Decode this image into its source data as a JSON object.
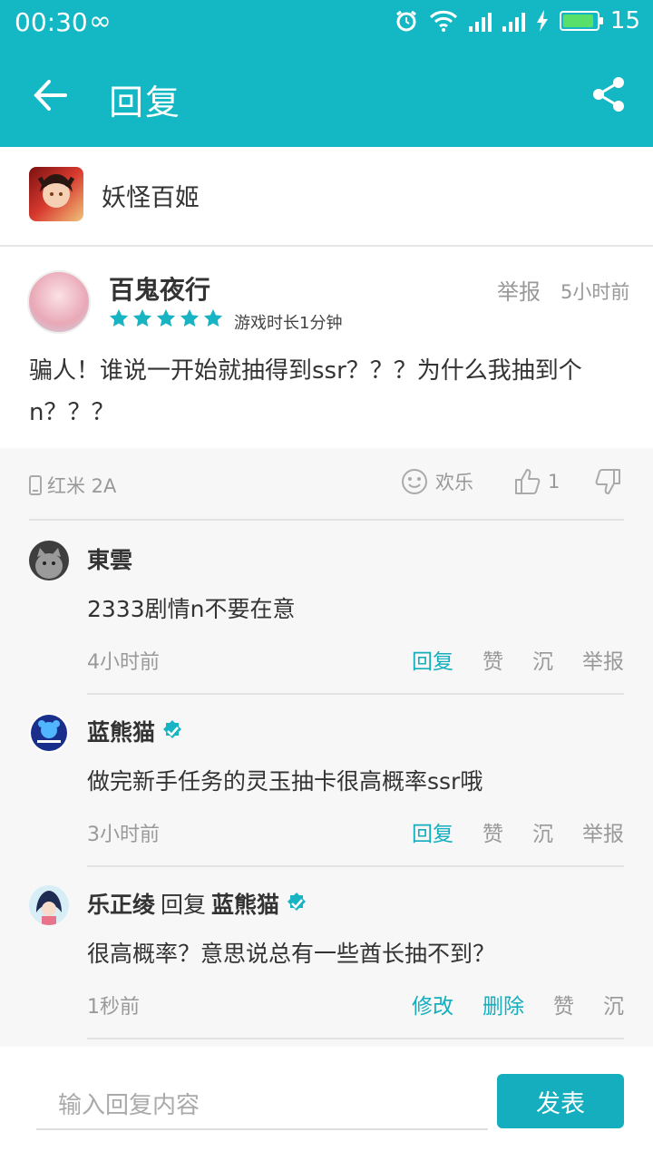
{
  "status_bar": {
    "time": "00:30",
    "infinity": "∞",
    "battery_level": "15",
    "battery_fill": 0.92
  },
  "app_bar": {
    "title": "回复"
  },
  "game": {
    "name": "妖怪百姬"
  },
  "post": {
    "author": "百鬼夜行",
    "report": "举报",
    "time_ago": "5小时前",
    "rating": 5,
    "playtime": "游戏时长1分钟",
    "text": "骗人！谁说一开始就抽得到ssr？？？为什么我抽到个n？？？",
    "device": "红米 2A",
    "mood": "欢乐",
    "likes": "1"
  },
  "replies": [
    {
      "name": "東雲",
      "text": "2333剧情n不要在意",
      "time": "4小时前",
      "actions": [
        "回复",
        "赞",
        "沉",
        "举报"
      ]
    },
    {
      "name": "蓝熊猫",
      "text": "做完新手任务的灵玉抽卡很高概率ssr哦",
      "time": "3小时前",
      "actions": [
        "回复",
        "赞",
        "沉",
        "举报"
      ]
    },
    {
      "name": "乐正绫",
      "reply_word": "回复",
      "reply_to": "蓝熊猫",
      "text": "很高概率？意思说总有一些酋长抽不到？",
      "time": "1秒前",
      "actions": [
        "修改",
        "删除",
        "赞",
        "沉"
      ]
    }
  ],
  "composer": {
    "placeholder": "输入回复内容",
    "send_label": "发表"
  },
  "colors": {
    "accent": "#14b7c4",
    "action_teal": "#14aebf",
    "star": "#19b4c4"
  }
}
